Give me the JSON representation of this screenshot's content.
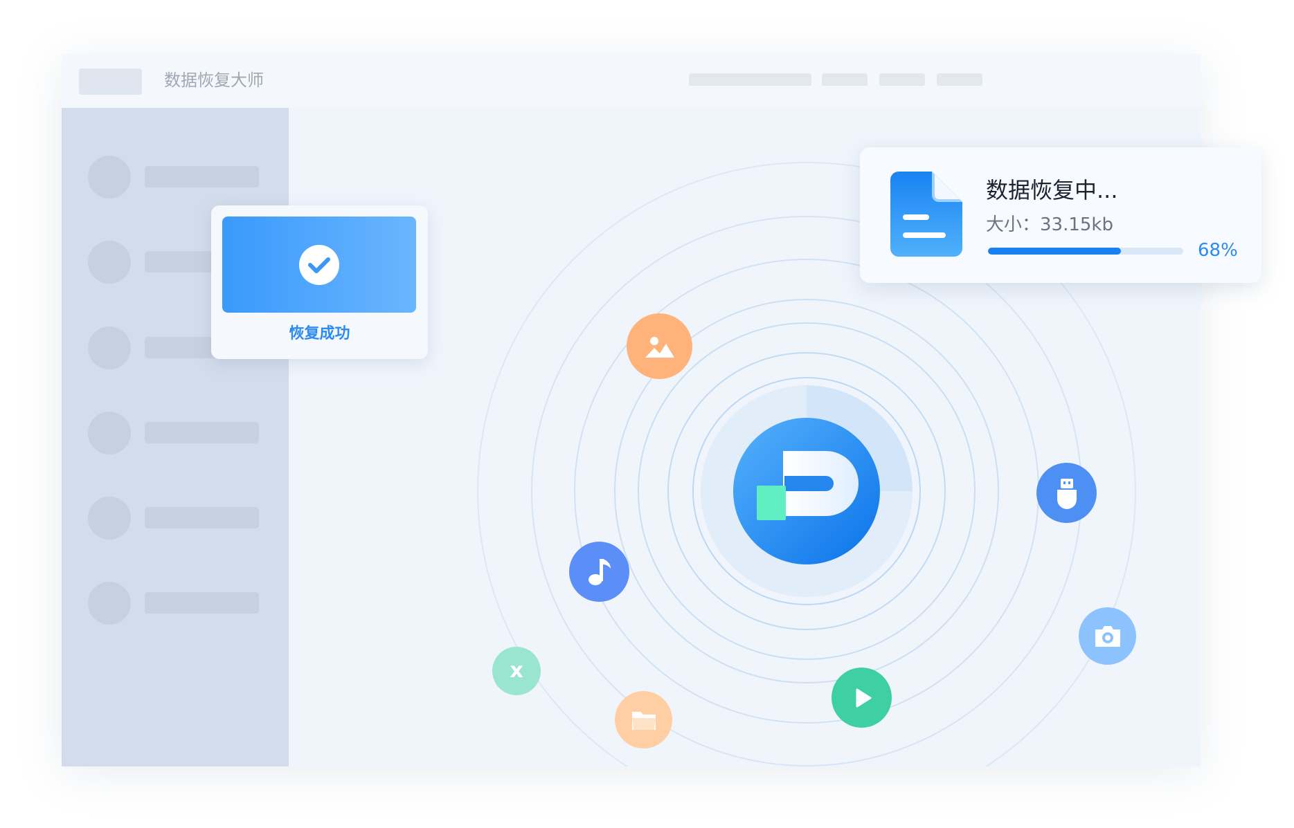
{
  "window": {
    "app_title": "数据恢复大师"
  },
  "success_card": {
    "label": "恢复成功",
    "icon": "check-circle-icon"
  },
  "progress_card": {
    "title": "数据恢复中...",
    "size_text": "大小：33.15kb",
    "percent_text": "68%",
    "progress": 0.68,
    "icon": "document-icon"
  },
  "orbit_icons": [
    {
      "name": "image-icon",
      "color": "#ffb37a"
    },
    {
      "name": "usb-icon",
      "color": "#4e8ff3"
    },
    {
      "name": "music-icon",
      "color": "#5b8ef7"
    },
    {
      "name": "camera-icon",
      "color": "#8cc2fd"
    },
    {
      "name": "excel-icon",
      "color": "#99e5cf",
      "glyph": "x"
    },
    {
      "name": "folder-icon",
      "color": "#ffcfa3"
    },
    {
      "name": "play-icon",
      "color": "#3ecfa3"
    }
  ],
  "colors": {
    "accent": "#2b8bf2",
    "sidebar": "#d3dcea",
    "background": "#f0f5fc"
  }
}
